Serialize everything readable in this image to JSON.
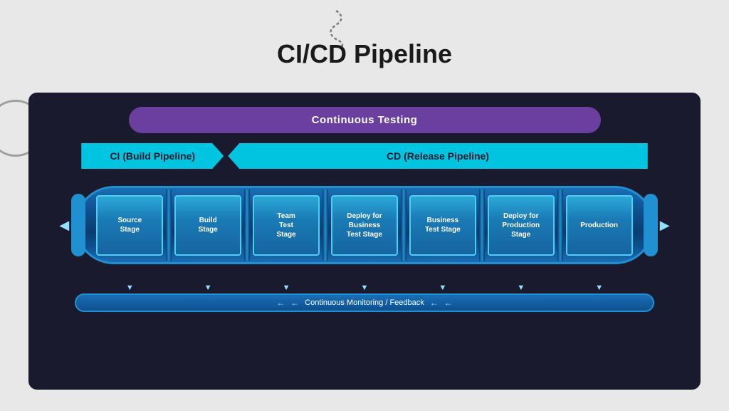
{
  "page": {
    "title": "CI/CD Pipeline",
    "background_color": "#e8e8e8"
  },
  "continuous_testing": {
    "label": "Continuous Testing",
    "bg_color": "#6b3fa0"
  },
  "ci_label": {
    "text": "CI (Build Pipeline)",
    "bg_color": "#00c4e0"
  },
  "cd_label": {
    "text": "CD (Release Pipeline)",
    "bg_color": "#00c4e0"
  },
  "stages": [
    {
      "id": "source",
      "label": "Source\nStage"
    },
    {
      "id": "build",
      "label": "Build\nStage"
    },
    {
      "id": "team-test",
      "label": "Team\nTest\nStage"
    },
    {
      "id": "deploy-business",
      "label": "Deploy for\nBusiness\nTest Stage"
    },
    {
      "id": "business-test",
      "label": "Business\nTest Stage"
    },
    {
      "id": "deploy-production",
      "label": "Deploy for\nProduction\nStage"
    },
    {
      "id": "production",
      "label": "Production"
    }
  ],
  "feedback": {
    "label": "Continuous Monitoring / Feedback"
  }
}
